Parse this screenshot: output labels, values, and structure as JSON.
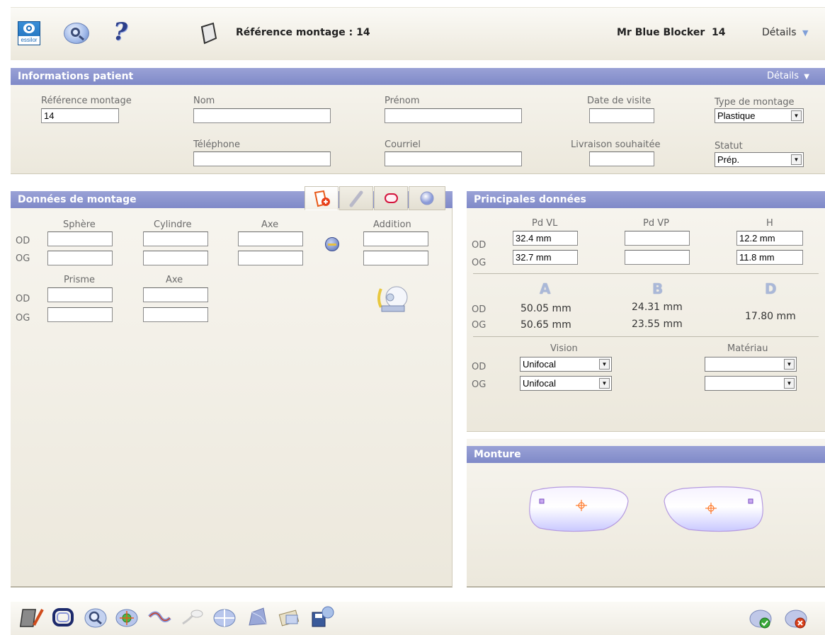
{
  "header": {
    "title": "Référence montage : 14",
    "patient_name": "Mr Blue Blocker",
    "patient_number": "14",
    "details_label": "Détails",
    "logo_text": "essilor"
  },
  "patient_info": {
    "band_title": "Informations patient",
    "details_label": "Détails",
    "ref_label": "Référence montage",
    "ref_value": "14",
    "nom_label": "Nom",
    "nom_value": "",
    "prenom_label": "Prénom",
    "prenom_value": "",
    "date_label": "Date de visite",
    "date_value": "",
    "type_label": "Type de montage",
    "type_value": "Plastique",
    "tel_label": "Téléphone",
    "tel_value": "",
    "courriel_label": "Courriel",
    "courriel_value": "",
    "livraison_label": "Livraison souhaitée",
    "livraison_value": "",
    "statut_label": "Statut",
    "statut_value": "Prép."
  },
  "montage": {
    "band_title": "Données de montage",
    "sphere_label": "Sphère",
    "cylindre_label": "Cylindre",
    "axe_label": "Axe",
    "addition_label": "Addition",
    "prisme_label": "Prisme",
    "axe2_label": "Axe",
    "od_label": "OD",
    "og_label": "OG"
  },
  "principales": {
    "band_title": "Principales données",
    "pdvl_label": "Pd VL",
    "pdvp_label": "Pd VP",
    "h_label": "H",
    "od_label": "OD",
    "og_label": "OG",
    "od_pdvl": "32.4 mm",
    "og_pdvl": "32.7 mm",
    "od_pdvp": "",
    "og_pdvp": "",
    "od_h": "12.2 mm",
    "og_h": "11.8 mm",
    "a_label": "A",
    "b_label": "B",
    "d_label": "D",
    "od_a": "50.05 mm",
    "og_a": "50.65 mm",
    "od_b": "24.31 mm",
    "og_b": "23.55 mm",
    "d_value": "17.80 mm",
    "vision_label": "Vision",
    "materiau_label": "Matériau",
    "od_vision": "Unifocal",
    "og_vision": "Unifocal",
    "od_materiau": "",
    "og_materiau": ""
  },
  "monture": {
    "band_title": "Monture"
  },
  "colors": {
    "band": "#8a93cf",
    "panel": "#efece3",
    "lens_fill": "#dcdcff",
    "lens_stroke": "#b59ae0",
    "cross": "#ff7a2a"
  }
}
